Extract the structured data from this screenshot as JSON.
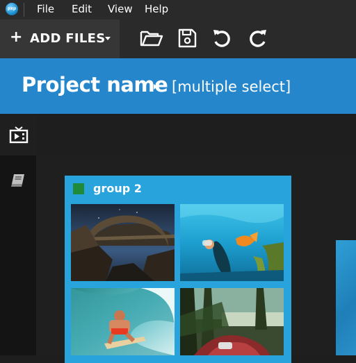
{
  "menubar": {
    "app_icon_text": "pxp",
    "items": [
      {
        "label": "File"
      },
      {
        "label": "Edit"
      },
      {
        "label": "View"
      },
      {
        "label": "Help"
      }
    ]
  },
  "toolbar": {
    "add_files_plus": "+",
    "add_files_label": "ADD FILES",
    "icons": [
      "folder-open-icon",
      "save-icon",
      "undo-icon",
      "redo-icon"
    ]
  },
  "header": {
    "project_name": "Project name",
    "selection": "[multiple select]"
  },
  "sidebar": {
    "icons": [
      "media-icon",
      "library-icon"
    ]
  },
  "group": {
    "name": "group 2",
    "color": "#1e8a3a",
    "thumbnails": [
      {
        "subject": "rock arch bridge at night"
      },
      {
        "subject": "underwater diver with fish"
      },
      {
        "subject": "surfer in wave"
      },
      {
        "subject": "forest lake hammock"
      }
    ]
  },
  "colors": {
    "accent": "#2586cc",
    "group_card": "#29a3dc",
    "menubar_bg": "#2a2a2a"
  }
}
